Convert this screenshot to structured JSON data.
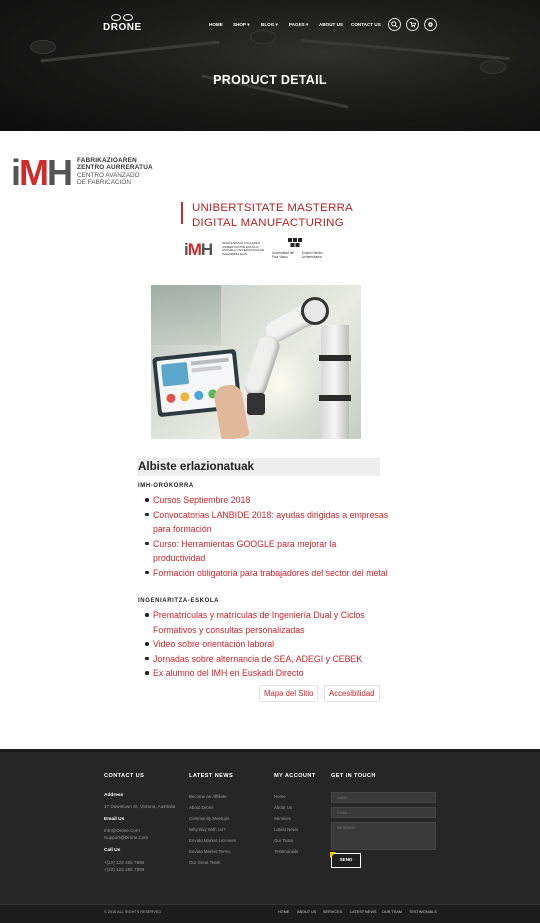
{
  "brand": {
    "name": "DRONE"
  },
  "nav": {
    "items": [
      "HOME",
      "SHOP",
      "BLOG",
      "PAGES",
      "ABOUT US",
      "CONTACT US"
    ],
    "search_icon": "search-icon",
    "cart_icon": "cart-icon",
    "settings_icon": "gear-icon"
  },
  "hero": {
    "title": "PRODUCT DETAIL"
  },
  "imh_logo": {
    "letters": [
      "i",
      "M",
      "H"
    ],
    "line1": "FABRIKAZIOAREN",
    "line2": "ZENTRO AURRERATUA",
    "line3": "CENTRO AVANZADO",
    "line4": "DE FABRICACIÓN"
  },
  "master_banner": {
    "line1": "UNIBERTSITATE MASTERRA",
    "line2": "DIGITAL MANUFACTURING",
    "imh_mini": [
      "i",
      "M",
      "H"
    ],
    "school_text": "INGENIARITZA DUALAREN UNIBERTSITATE ESKOLA / ESCUELA UNIVERSITARIA DE INGENIERÍA DUAL",
    "ehu_left": "Universidad del País Vasco",
    "ehu_right": "Euskal Herriko Unibertsitatea"
  },
  "news": {
    "heading": "Albiste erlazionatuak",
    "categories": [
      {
        "name": "IMH-OROKORRA",
        "items": [
          "Cursos Septiembre 2018",
          "Convocatorias LANBIDE 2018: ayudas dirigidas a empresas para formación",
          "Curso: Herramientas GOOGLE para mejorar la productividad",
          "Formación obligatoria para trabajadores del sector del metal"
        ]
      },
      {
        "name": "INGENIARITZA-ESKOLA",
        "items": [
          "Prematrículas y matrículas de Ingeniería Dual y Ciclos Formativos y consultas personalizadas",
          "Video sobre orientación laboral",
          "Jornadas sobre alternancia de SEA, ADEGI y CEBEK",
          "Ex alumno del IMH en Euskadi Directo"
        ]
      }
    ],
    "sitemap": "Mapa del Sitio",
    "accessibility": "Accesibilidad"
  },
  "footer": {
    "contact": {
      "title": "CONTACT US",
      "address_label": "Address",
      "address": "17 Downtown St, Victoria, Australia",
      "email_label": "Email Us",
      "emails": [
        "Info@Drone.Com",
        "Support@Drone.Com"
      ],
      "call_label": "Call Us",
      "phones": [
        "+(10) 123 456 7896",
        "+(10) 123 456 7899"
      ]
    },
    "latest_news": {
      "title": "LATEST NEWS",
      "items": [
        "Become an Affiliate",
        "About Drone",
        "Community Meetups",
        "Why Buy With Us?",
        "Envato Market Licenses",
        "Envato Market Terms",
        "Our Great Team"
      ]
    },
    "account": {
      "title": "MY ACCOUNT",
      "items": [
        "Home",
        "About Us",
        "Services",
        "Latest News",
        "Our Team",
        "Testimonials"
      ]
    },
    "touch": {
      "title": "GET IN TOUCH",
      "name_placeholder": "NAME",
      "email_placeholder": "EMAIL",
      "message_placeholder": "MESSAGE",
      "send": "SEND"
    },
    "copyright": "© 2016 ALL RIGHTS RESERVED",
    "bottom_links": [
      "HOME",
      "ABOUT US",
      "SERVICES",
      "LATEST NEWS",
      "OUR TEAM",
      "TESTIMONIALS"
    ]
  }
}
